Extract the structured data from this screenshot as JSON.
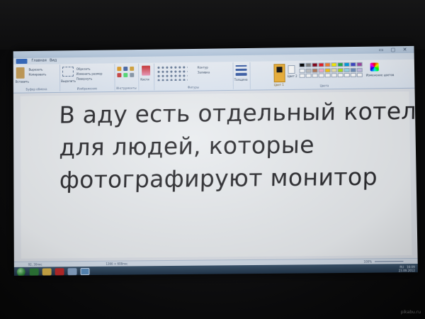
{
  "window": {
    "title": "",
    "controls": "▭ ▢ ✕"
  },
  "menu": {
    "tabs": [
      "Главная",
      "Вид"
    ]
  },
  "ribbon": {
    "groups": [
      {
        "name": "Буфер обмена",
        "items": [
          "Вставить",
          "Вырезать",
          "Копировать"
        ]
      },
      {
        "name": "Изображение",
        "items": [
          "Выделить",
          "Обрезать",
          "Изменить размер",
          "Повернуть"
        ]
      },
      {
        "name": "Инструменты",
        "items": []
      },
      {
        "name": "",
        "items": [
          "Кисти"
        ]
      },
      {
        "name": "Фигуры",
        "items": [
          "Контур",
          "Заливка"
        ]
      },
      {
        "name": "",
        "items": [
          "Толщина"
        ]
      },
      {
        "name": "Цвета",
        "items": [
          "Цвет 1",
          "Цвет 2",
          "Изменение цветов"
        ]
      }
    ],
    "palette": [
      "#000000",
      "#7f7f7f",
      "#880015",
      "#ed1c24",
      "#ff7f27",
      "#fff200",
      "#22b14c",
      "#00a2e8",
      "#3f48cc",
      "#a349a4",
      "#ffffff",
      "#c3c3c3",
      "#b97a57",
      "#ffaec9",
      "#ffc90e",
      "#efe4b0",
      "#b5e61d",
      "#99d9ea",
      "#7092be",
      "#c8bfe7",
      "#ffffff",
      "#ffffff",
      "#ffffff",
      "#ffffff",
      "#ffffff",
      "#ffffff",
      "#ffffff",
      "#ffffff",
      "#ffffff",
      "#ffffff"
    ]
  },
  "canvas": {
    "lines": [
      "В аду есть отдельный котел",
      "для людей, которые",
      "фотографируют монитор"
    ]
  },
  "statusbar": {
    "left": "92, 30пкс",
    "size": "1366 × 608пкс",
    "zoom": "100%"
  },
  "taskbar": {
    "lang": "RU",
    "time": "16:09",
    "date": "23.09.2012"
  },
  "watermark": "pikabu.ru",
  "colors": {
    "ribbon_bg": "#e6edf6",
    "titlebar": "#c0d3ea",
    "text": "#2a2a2e",
    "taskbar": "#2c4258",
    "color1_frame": "#f0b237"
  }
}
